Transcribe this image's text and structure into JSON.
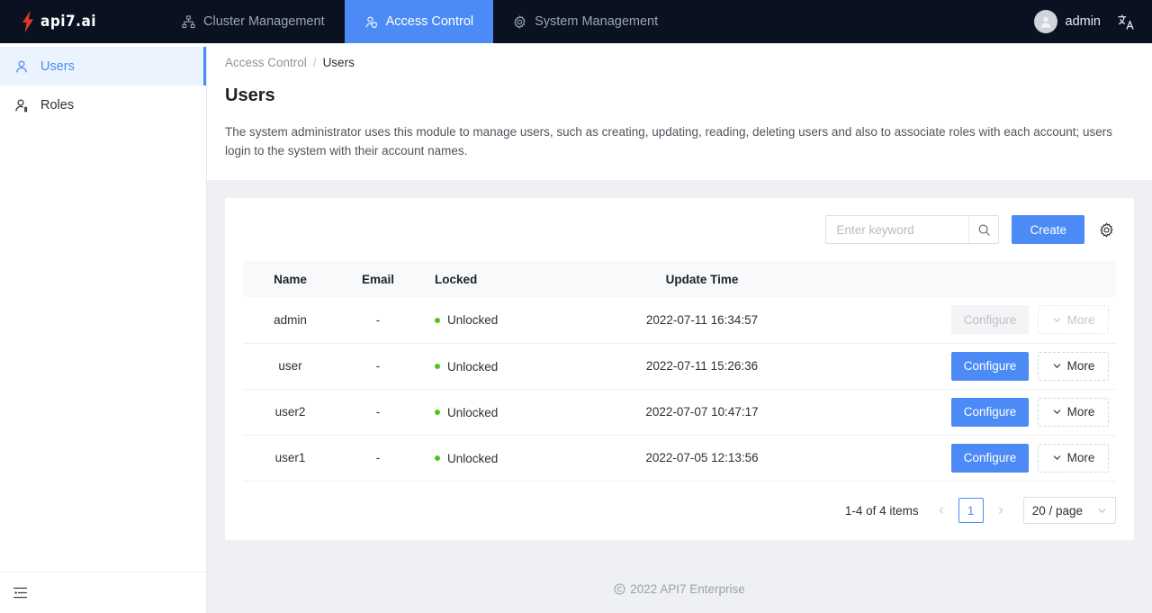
{
  "header": {
    "logo_text": "api7.ai",
    "logo_icon": "lightning-bolt-icon",
    "nav": [
      {
        "label": "Cluster Management",
        "icon": "sitemap-icon",
        "active": false
      },
      {
        "label": "Access Control",
        "icon": "user-shield-icon",
        "active": true
      },
      {
        "label": "System Management",
        "icon": "gear-icon",
        "active": false
      }
    ],
    "user": "admin",
    "user_icon": "avatar-icon",
    "language_icon": "translate-icon",
    "accent_color": "#4c8bf5",
    "background_color": "#0a1222"
  },
  "sidebar": {
    "items": [
      {
        "label": "Users",
        "icon": "user-icon",
        "active": true
      },
      {
        "label": "Roles",
        "icon": "user-group-icon",
        "active": false
      }
    ],
    "collapse_icon": "menu-fold-icon"
  },
  "breadcrumb": {
    "parent": "Access Control",
    "separator": "/",
    "current": "Users"
  },
  "page": {
    "title": "Users",
    "description": "The system administrator uses this module to manage users, such as creating, updating, reading, deleting users and also to associate roles with each account; users login to the system with their account names."
  },
  "toolbar": {
    "search_placeholder": "Enter keyword",
    "search_value": "",
    "search_icon": "search-icon",
    "create_label": "Create",
    "settings_icon": "gear-icon"
  },
  "table": {
    "columns": [
      "Name",
      "Email",
      "Locked",
      "Update Time"
    ],
    "rows": [
      {
        "name": "admin",
        "email": "-",
        "locked": "Unlocked",
        "locked_color": "#52c41a",
        "update_time": "2022-07-11 16:34:57",
        "configure_label": "Configure",
        "more_label": "More",
        "disabled": true
      },
      {
        "name": "user",
        "email": "-",
        "locked": "Unlocked",
        "locked_color": "#52c41a",
        "update_time": "2022-07-11 15:26:36",
        "configure_label": "Configure",
        "more_label": "More",
        "disabled": false
      },
      {
        "name": "user2",
        "email": "-",
        "locked": "Unlocked",
        "locked_color": "#52c41a",
        "update_time": "2022-07-07 10:47:17",
        "configure_label": "Configure",
        "more_label": "More",
        "disabled": false
      },
      {
        "name": "user1",
        "email": "-",
        "locked": "Unlocked",
        "locked_color": "#52c41a",
        "update_time": "2022-07-05 12:13:56",
        "configure_label": "Configure",
        "more_label": "More",
        "disabled": false
      }
    ]
  },
  "pagination": {
    "total_text": "1-4 of 4 items",
    "prev_icon": "chevron-left-icon",
    "next_icon": "chevron-right-icon",
    "current_page": "1",
    "page_size": "20 / page"
  },
  "footer": {
    "copyright_icon": "copyright-icon",
    "text": "2022 API7 Enterprise"
  }
}
